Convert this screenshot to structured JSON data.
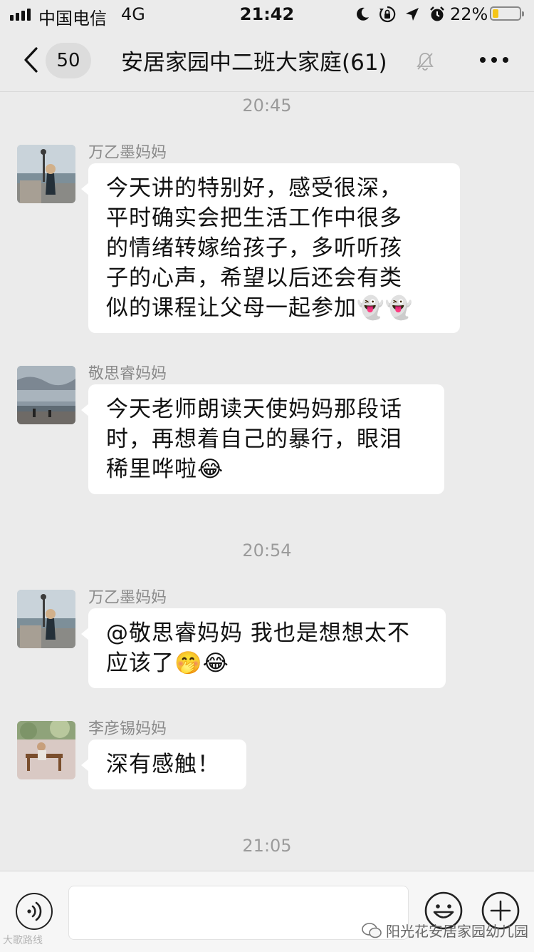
{
  "status_bar": {
    "carrier": "中国电信",
    "network": "4G",
    "time": "21:42",
    "battery_percent_label": "22%",
    "battery_level": 0.22,
    "icons": [
      "moon-icon",
      "rotation-lock-icon",
      "location-arrow-icon",
      "alarm-icon"
    ]
  },
  "nav": {
    "unread_count": "50",
    "title": "安居家园中二班大家庭(61)",
    "icons": [
      "back-chevron-icon",
      "mute-bell-icon",
      "more-dots-icon"
    ]
  },
  "chat": {
    "timestamps": [
      "20:45",
      "20:54",
      "21:05"
    ],
    "messages": [
      {
        "sender": "万乙墨妈妈",
        "lines": [
          "今天讲的特别好，感受很深，",
          "平时确实会把生活工作中很多",
          "的情绪转嫁给孩子，多听听孩",
          "子的心声，希望以后还会有类",
          "似的课程让父母一起参加👻👻"
        ]
      },
      {
        "sender": "敬思睿妈妈",
        "lines": [
          "今天老师朗读天使妈妈那段话",
          "时，再想着自己的暴行，眼泪",
          "稀里哗啦😂"
        ]
      },
      {
        "sender": "万乙墨妈妈",
        "lines": [
          "@敬思睿妈妈 我也是想想太不",
          "应该了🤭😂"
        ]
      },
      {
        "sender": "李彦锡妈妈",
        "lines": [
          "深有感触！"
        ]
      }
    ]
  },
  "input_bar": {
    "icons": [
      "voice-icon",
      "emoji-icon",
      "plus-icon"
    ]
  },
  "watermarks": {
    "left": "大歌路线",
    "right": "阳光花安居家园幼儿园"
  },
  "colors": {
    "background": "#ebebeb",
    "bubble": "#ffffff",
    "battery": "#f5c518"
  }
}
